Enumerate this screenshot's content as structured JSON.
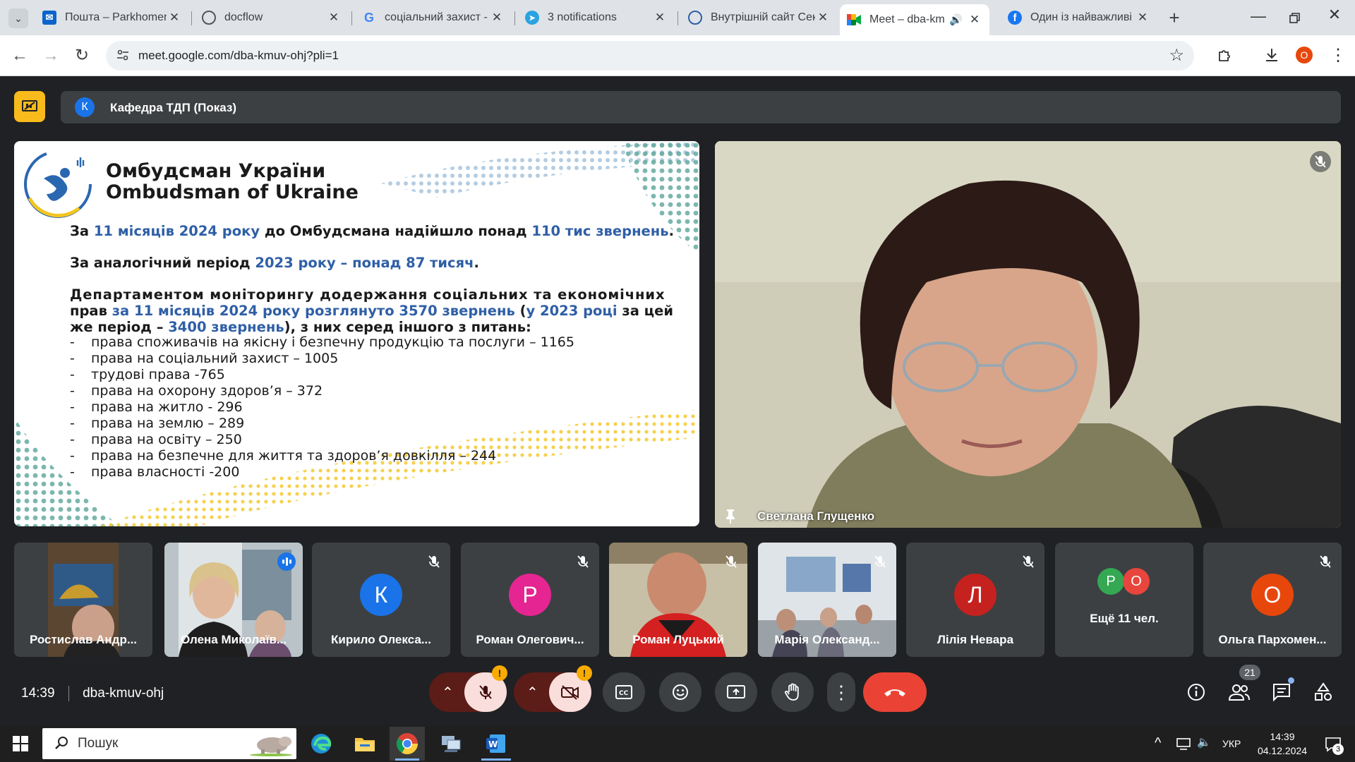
{
  "browser": {
    "tabs": [
      {
        "title": "Пошта – Parkhomenko",
        "fav": "mail-icon"
      },
      {
        "title": "docflow",
        "fav": "globe-icon"
      },
      {
        "title": "соціальний захист -",
        "fav": "google-icon"
      },
      {
        "title": "3 notifications",
        "fav": "telegram-icon"
      },
      {
        "title": "Внутрішній сайт Сек",
        "fav": "site-icon"
      },
      {
        "title": "Meet – dba-kmuv",
        "fav": "meet-icon"
      },
      {
        "title": "Один із найважливі",
        "fav": "facebook-icon"
      }
    ],
    "url": "meet.google.com/dba-kmuv-ohj?pli=1",
    "profile_initial": "О"
  },
  "meet": {
    "presenter_initial": "К",
    "presenter_label": "Кафедра ТДП (Показ)",
    "speaker_name": "Светлана Глущенко",
    "time": "14:39",
    "meeting_code": "dba-kmuv-ohj",
    "people_count": "21"
  },
  "slide": {
    "org_ua": "Омбудсман України",
    "org_en": "Ombudsman of Ukraine",
    "p1_a": "За ",
    "p1_b": "11 місяців 2024 року",
    "p1_c": " до Омбудсмана надійшло понад ",
    "p1_d": "110 тис звернень",
    "p1_e": ".",
    "p2_a": "За аналогічний період ",
    "p2_b": "2023 року – понад 87 тисяч",
    "p2_c": ".",
    "p3_l1": "Департаментом моніторингу додержання соціальних та економічних",
    "p3_l2a": "прав ",
    "p3_l2b": "за 11 місяців 2024 року розглянуто 3570 звернень",
    "p3_l2c": " (",
    "p3_l2d": "у 2023 році",
    "p3_l2e": " за цей",
    "p3_l3a": "же період – ",
    "p3_l3b": "3400 звернень",
    "p3_l3c": "), з них серед іншого з питань:",
    "items": [
      "права споживачів на якісну і безпечну продукцію та послуги – 1165",
      "права на соціальний захист – 1005",
      "трудові права -765",
      "права на охорону здоров’я – 372",
      "права на  житло - 296",
      "права на землю – 289",
      "права на освіту – 250",
      "права на безпечне для життя та здоров’я довкілля – 244",
      "права власності -200"
    ]
  },
  "participants": [
    {
      "name": "Ростислав Андр...",
      "type": "video"
    },
    {
      "name": "Олена Миколаїв...",
      "type": "video"
    },
    {
      "name": "Кирило Олекса...",
      "initial": "К",
      "color": "#1a73e8"
    },
    {
      "name": "Роман Олегович...",
      "initial": "Р",
      "color": "#e52592"
    },
    {
      "name": "Роман Луцький",
      "type": "video"
    },
    {
      "name": "Марія Олександ...",
      "type": "video"
    },
    {
      "name": "Лілія Невара",
      "initial": "Л",
      "color": "#c5221f"
    },
    {
      "name": "Ещё 11 чел.",
      "initials": [
        "Р",
        "О"
      ],
      "colors": [
        "#34a853",
        "#e8453c"
      ]
    },
    {
      "name": "Ольга Пархомен...",
      "initial": "О",
      "color": "#e8470c"
    }
  ],
  "taskbar": {
    "search_placeholder": "Пошук",
    "lang": "УКР",
    "time": "14:39",
    "date": "04.12.2024",
    "notif_count": "3"
  }
}
